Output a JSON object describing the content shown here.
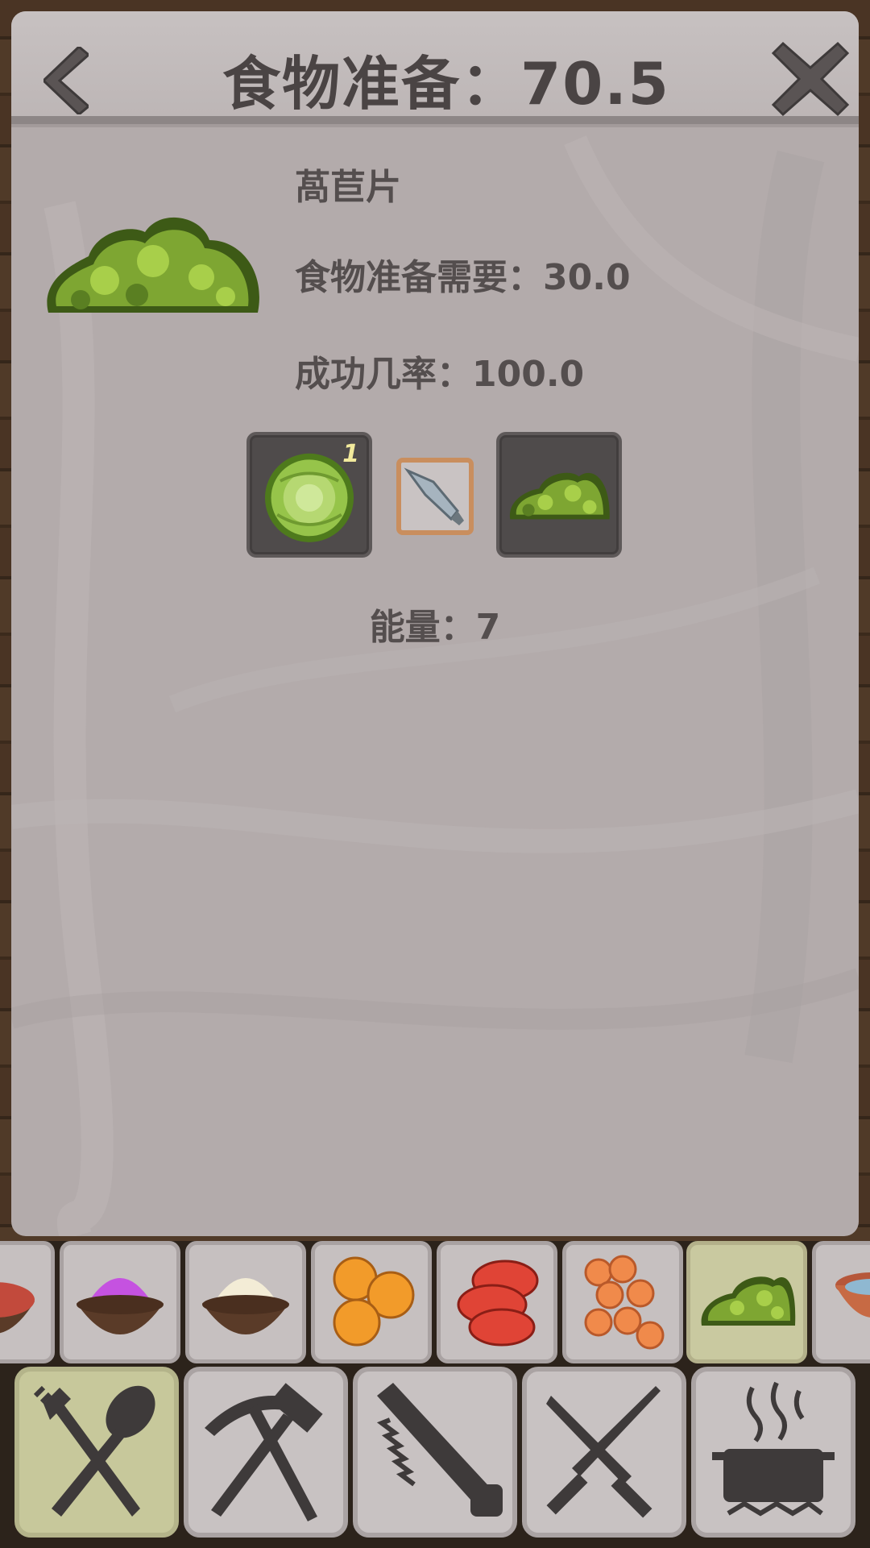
{
  "header": {
    "title": "食物准备：70.5"
  },
  "recipe": {
    "name": "萵苣片",
    "food_prep_required": "食物准备需要：30.0",
    "success_rate": "成功几率：100.0",
    "ingredient_quantity": "1",
    "energy": "能量：7"
  },
  "icons": {
    "back": "back-chevron-icon",
    "close": "close-x-icon",
    "recipe_image": "lettuce-shreds-icon",
    "ingredient": "lettuce-head-icon",
    "tool": "knife-blade-icon",
    "output": "lettuce-shreds-icon"
  },
  "recipe_strip": [
    {
      "name": "red-cream-coconut-icon",
      "active": false
    },
    {
      "name": "purple-cream-coconut-icon",
      "active": false
    },
    {
      "name": "white-cream-coconut-icon",
      "active": false
    },
    {
      "name": "orange-slices-icon",
      "active": false
    },
    {
      "name": "tomato-slices-icon",
      "active": false
    },
    {
      "name": "carrot-slices-icon",
      "active": false
    },
    {
      "name": "lettuce-shreds-icon",
      "active": true
    },
    {
      "name": "clay-pot-icon",
      "active": false
    }
  ],
  "categories": [
    {
      "name": "fork-spoon-icon",
      "active": true
    },
    {
      "name": "pickaxe-hammer-icon",
      "active": false
    },
    {
      "name": "saw-icon",
      "active": false
    },
    {
      "name": "crossed-knives-icon",
      "active": false
    },
    {
      "name": "cooking-pot-icon",
      "active": false
    }
  ],
  "colors": {
    "panel": "#b3abab",
    "text": "#544e4e",
    "active_tab": "#c7c89b",
    "lettuce_light": "#a8cf4a",
    "lettuce_dark": "#3d5a16"
  }
}
